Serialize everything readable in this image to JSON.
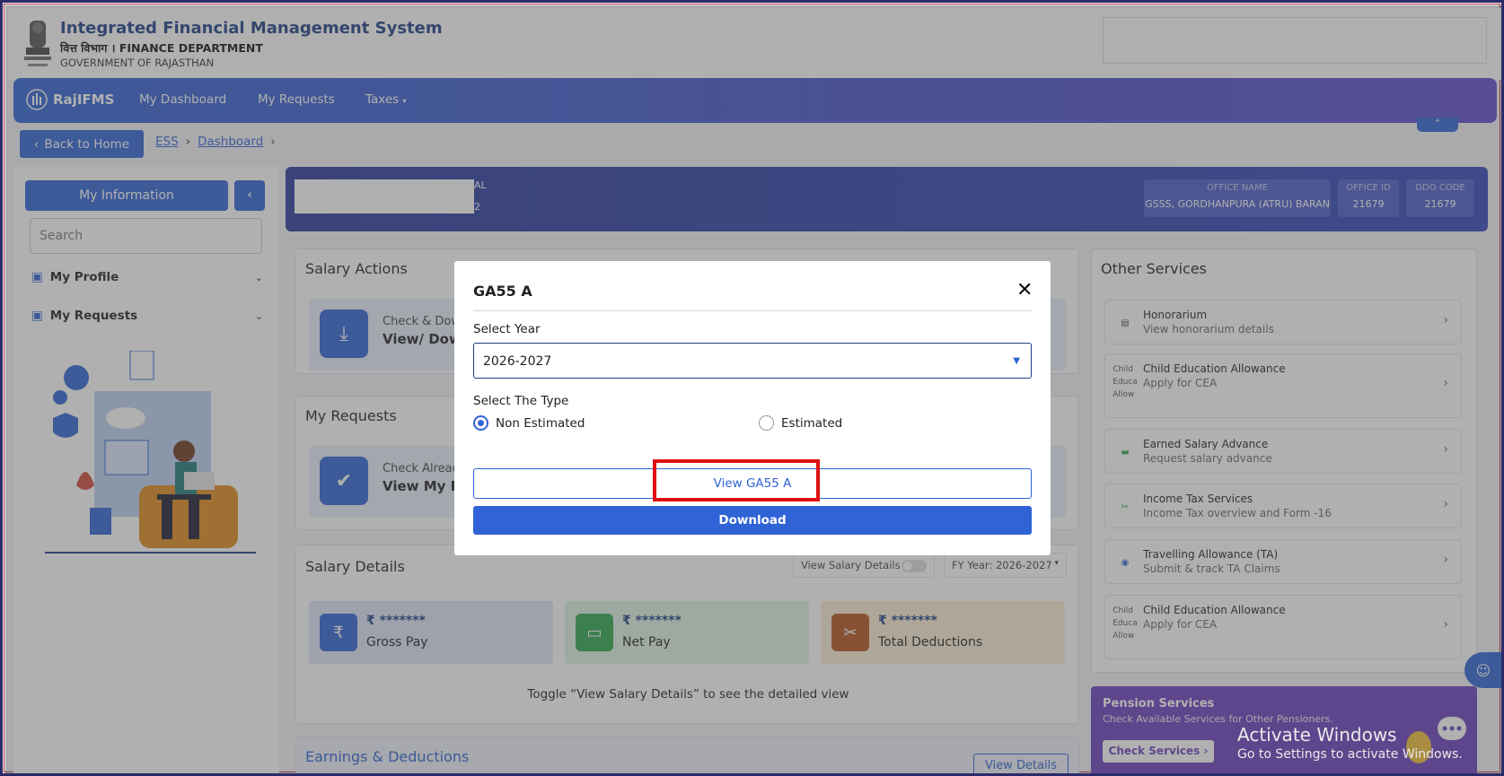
{
  "header": {
    "title": "Integrated Financial Management System",
    "subtitle": "वित्त विभाग । FINANCE DEPARTMENT",
    "org": "GOVERNMENT OF RAJASTHAN"
  },
  "nav": {
    "brand": "RajIFMS",
    "items": [
      "My Dashboard",
      "My Requests",
      "Taxes"
    ]
  },
  "breadcrumb": {
    "back": "Back to Home",
    "items": [
      "ESS",
      "Dashboard"
    ]
  },
  "sidebar": {
    "title": "My Information",
    "search_placeholder": "Search",
    "items": [
      "My Profile",
      "My Requests"
    ]
  },
  "banner": {
    "line1_tail": "AL",
    "line2_tail": "2",
    "office_name_label": "OFFICE NAME",
    "office_name": "GSSS, GORDHANPURA (ATRU) BARAN",
    "office_id_label": "OFFICE ID",
    "office_id": "21679",
    "ddo_code_label": "DDO CODE",
    "ddo_code": "21679"
  },
  "salary_actions": {
    "title": "Salary Actions",
    "card_line1": "Check & Dow",
    "card_line2": "View/ Down"
  },
  "my_requests": {
    "title": "My Requests",
    "card_line1": "Check Alread",
    "card_line2": "View My Re"
  },
  "salary_details": {
    "title": "Salary Details",
    "toggle_label": "View Salary Details",
    "fy_label": "FY Year: 2026-2027",
    "cards": [
      {
        "value": "₹ *******",
        "label": "Gross Pay"
      },
      {
        "value": "₹ *******",
        "label": "Net Pay"
      },
      {
        "value": "₹ *******",
        "label": "Total Deductions"
      }
    ],
    "hint": "Toggle “View Salary Details” to see the detailed view"
  },
  "earnings": {
    "title": "Earnings & Deductions",
    "button": "View Details"
  },
  "other_services": {
    "title": "Other Services",
    "items": [
      {
        "title": "Honorarium",
        "desc": "View honorarium details",
        "icon": "wallet-icon"
      },
      {
        "title": "Child Education Allowance",
        "desc": "Apply for CEA",
        "icon": "broken-image-icon",
        "alt": "Child Educa Allow"
      },
      {
        "title": "Earned Salary Advance",
        "desc": "Request salary advance",
        "icon": "cash-icon"
      },
      {
        "title": "Income Tax Services",
        "desc": "Income Tax overview and Form -16",
        "icon": "tax-icon"
      },
      {
        "title": "Travelling Allowance (TA)",
        "desc": "Submit & track TA Claims",
        "icon": "location-icon"
      },
      {
        "title": "Child Education Allowance",
        "desc": "Apply for CEA",
        "icon": "broken-image-icon",
        "alt": "Child Educa Allow"
      }
    ]
  },
  "pension": {
    "title": "Pension Services",
    "desc": "Check Available Services for Other Pensioners.",
    "button": "Check Services"
  },
  "modal": {
    "title": "GA55 A",
    "year_label": "Select Year",
    "year_value": "2026-2027",
    "type_label": "Select The Type",
    "option_1": "Non Estimated",
    "option_2": "Estimated",
    "selected_option": "Non Estimated",
    "view_button": "View GA55 A",
    "download_button": "Download"
  },
  "watermark": {
    "line1": "Activate Windows",
    "line2": "Go to Settings to activate Windows."
  },
  "colors": {
    "primary": "#2f63d6",
    "navy": "#1c3e86",
    "highlight": "#e01010",
    "pension": "#6b3fbf"
  }
}
